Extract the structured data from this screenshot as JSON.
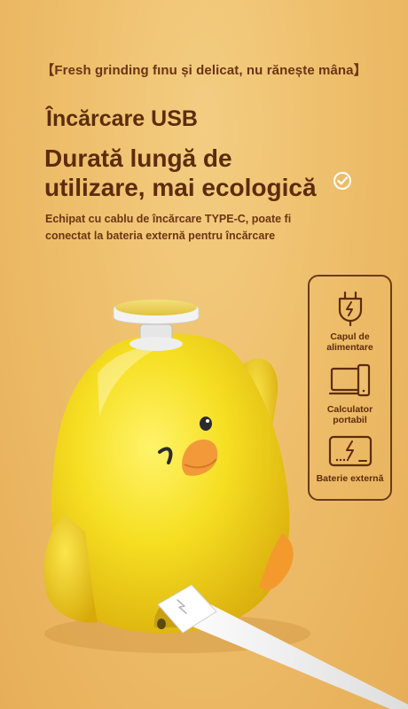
{
  "header": {
    "tagline": "【Fresh grinding fınu și delicat, nu rănește mâna】",
    "title": "Încărcare USB",
    "headline_line1": "Durată lungă de",
    "headline_line2": "utilizare, mai ecologică",
    "description_line1": "Echipat cu cablu de încărcare TYPE-C, poate fi",
    "description_line2": "conectat la bateria externă pentru încărcare"
  },
  "panel": {
    "items": [
      {
        "icon": "power-plug-icon",
        "label_line1": "Capul de",
        "label_line2": "alimentare"
      },
      {
        "icon": "computer-icon",
        "label_line1": "Calculator",
        "label_line2": "portabil"
      },
      {
        "icon": "power-bank-icon",
        "label_line1": "Baterie externă",
        "label_line2": ""
      }
    ]
  },
  "colors": {
    "background": "#eebf6c",
    "text_dark": "#5d2c0c",
    "chick_yellow": "#f5dc1f",
    "beak_orange": "#f29a3a"
  }
}
